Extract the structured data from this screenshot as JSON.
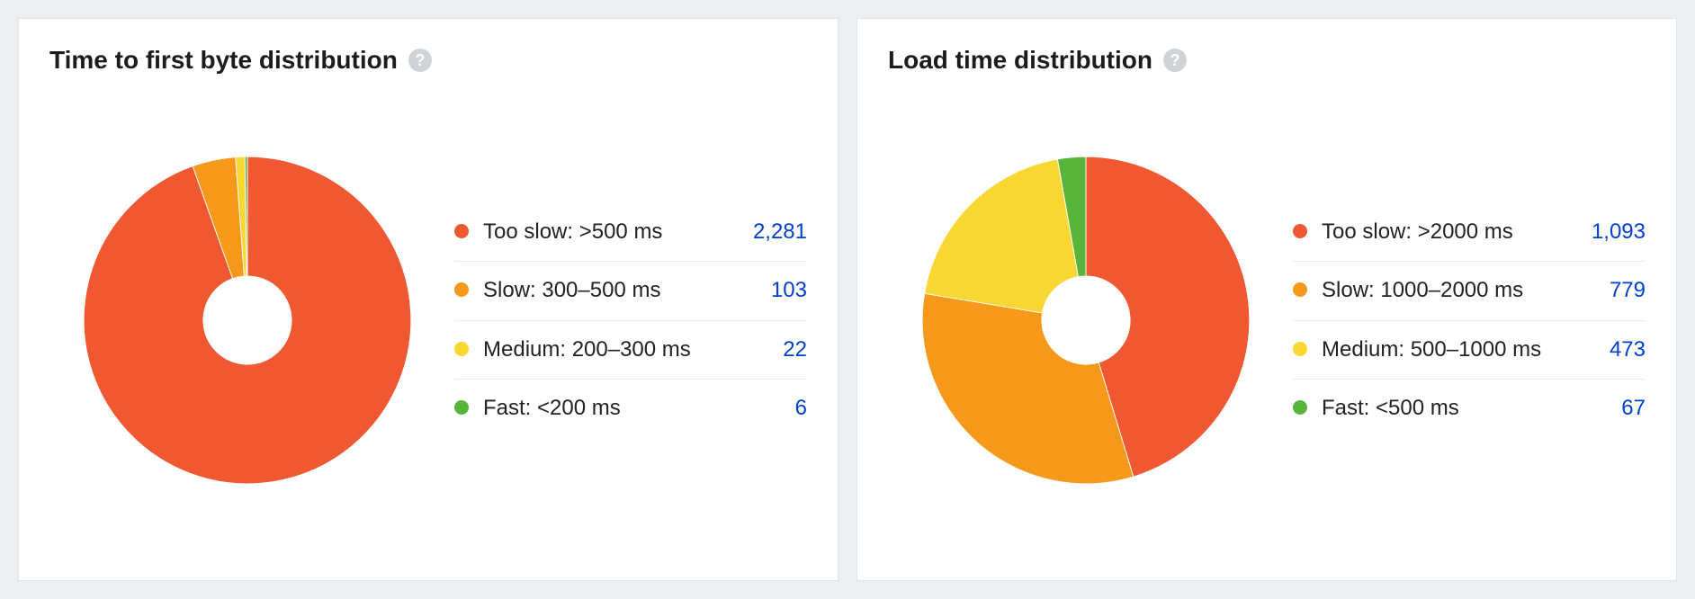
{
  "chart_data": [
    {
      "id": "ttfb",
      "type": "pie",
      "title": "Time to first byte distribution",
      "inner_radius_ratio": 0.27,
      "series": [
        {
          "name": "Too slow: >500 ms",
          "value": 2281,
          "value_display": "2,281",
          "color": "#ef5831"
        },
        {
          "name": "Slow: 300–500 ms",
          "value": 103,
          "value_display": "103",
          "color": "#f6991a"
        },
        {
          "name": "Medium: 200–300 ms",
          "value": 22,
          "value_display": "22",
          "color": "#f9d733"
        },
        {
          "name": "Fast: <200 ms",
          "value": 6,
          "value_display": "6",
          "color": "#59b53a"
        }
      ]
    },
    {
      "id": "loadtime",
      "type": "pie",
      "title": "Load time distribution",
      "inner_radius_ratio": 0.27,
      "series": [
        {
          "name": "Too slow: >2000 ms",
          "value": 1093,
          "value_display": "1,093",
          "color": "#ef5831"
        },
        {
          "name": "Slow: 1000–2000 ms",
          "value": 779,
          "value_display": "779",
          "color": "#f6991a"
        },
        {
          "name": "Medium: 500–1000 ms",
          "value": 473,
          "value_display": "473",
          "color": "#f9d733"
        },
        {
          "name": "Fast: <500 ms",
          "value": 67,
          "value_display": "67",
          "color": "#59b53a"
        }
      ]
    }
  ]
}
